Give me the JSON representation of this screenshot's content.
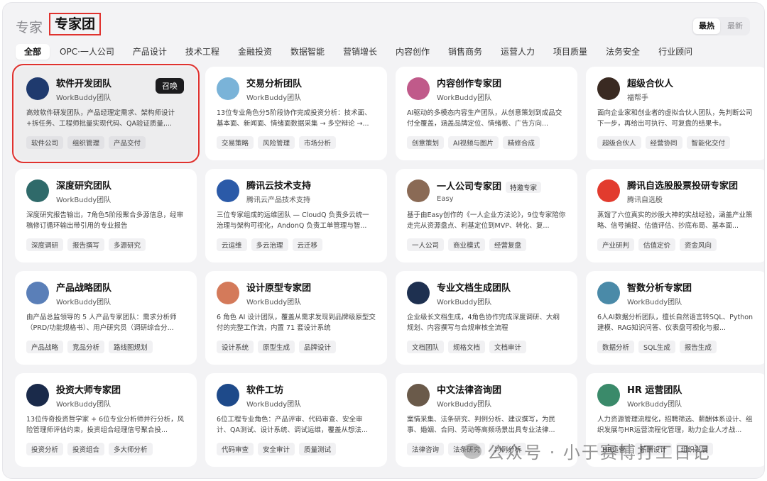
{
  "header": {
    "title_dim": "专家",
    "title_main": "专家团"
  },
  "sort": {
    "hot": "最热",
    "new": "最新"
  },
  "tabs": [
    "全部",
    "OPC·一人公司",
    "产品设计",
    "技术工程",
    "金融投资",
    "数据智能",
    "营销增长",
    "内容创作",
    "销售商务",
    "运营人力",
    "项目质量",
    "法务安全",
    "行业顾问"
  ],
  "cards": [
    {
      "name": "软件开发团队",
      "org": "WorkBuddy团队",
      "desc": "高效软件研发团队，产品经理定需求、架构师设计+拆任务、工程师批量实现代码、QA验证质量,...",
      "tags": [
        "软件公司",
        "组织管理",
        "产品交付"
      ],
      "avatar_color": "#1f3a6e",
      "summon": "召唤"
    },
    {
      "name": "交易分析团队",
      "org": "WorkBuddy团队",
      "desc": "13位专业角色分5阶段协作完成投资分析：技术面、基本面、新闻面、情绪面数据采集 → 多空辩论 →...",
      "tags": [
        "交易策略",
        "风险管理",
        "市场分析"
      ],
      "avatar_color": "#7ab3d8"
    },
    {
      "name": "内容创作专家团",
      "org": "WorkBuddy团队",
      "desc": "AI驱动的多模态内容生产团队，从创意策划到成品交付全覆盖，涵盖品牌定位、情绪板、广告方向...",
      "tags": [
        "创意策划",
        "AI视频与图片",
        "精修合成"
      ],
      "avatar_color": "#c05a8a"
    },
    {
      "name": "超级合伙人",
      "org": "福帮手",
      "desc": "面向企业家和创业者的虚拟合伙人团队，先判断公司下一步，再给出可执行、可复盘的结果卡。",
      "tags": [
        "超级合伙人",
        "经营协同",
        "智能化交付"
      ],
      "avatar_color": "#3a2a22"
    },
    {
      "name": "深度研究团队",
      "org": "WorkBuddy团队",
      "desc": "深度研究报告输出，7角色5阶段聚合多源信息，经审稿修订循环输出带引用的专业报告",
      "tags": [
        "深度调研",
        "报告撰写",
        "多源研究"
      ],
      "avatar_color": "#2f6a6a"
    },
    {
      "name": "腾讯云技术支持",
      "org": "腾讯云产品技术支持",
      "desc": "三位专家组成的运维团队 — CloudQ 负责多云统一治理与架构可视化，AndonQ 负责工单管理与智...",
      "tags": [
        "云运维",
        "多云治理",
        "云迁移"
      ],
      "avatar_color": "#2b5aa8"
    },
    {
      "name": "一人公司专家团",
      "org": "Easy",
      "badge": "特邀专家",
      "desc": "基于由Easy创作的《一人企业方法论》，9位专家陪你走完从资源盘点、利基定位到MVP、转化、复...",
      "tags": [
        "一人公司",
        "商业模式",
        "经营复盘"
      ],
      "avatar_color": "#8a6a55"
    },
    {
      "name": "腾讯自选股股票投研专家团",
      "org": "腾讯自选股",
      "desc": "蒸馏了六位真实的炒股大神的实战经验，涵盖产业策略、信号捕捉、估值评估、抄底布局、基本面...",
      "tags": [
        "产业研判",
        "估值定价",
        "资金风向"
      ],
      "avatar_color": "#e23b2e"
    },
    {
      "name": "产品战略团队",
      "org": "WorkBuddy团队",
      "desc": "由产品总监领导的 5 人产品专家团队：需求分析师（PRD/功能规格书）、用户研究员（调研综合分...",
      "tags": [
        "产品战略",
        "竞品分析",
        "路线图规划"
      ],
      "avatar_color": "#5a7fb8"
    },
    {
      "name": "设计原型专家团",
      "org": "WorkBuddy团队",
      "desc": "6 角色 AI 设计团队，覆盖从需求发现到品牌级原型交付的完整工作流，内置 71 套设计系统",
      "tags": [
        "设计系统",
        "原型生成",
        "品牌设计"
      ],
      "avatar_color": "#d47a5a"
    },
    {
      "name": "专业文档生成团队",
      "org": "WorkBuddy团队",
      "desc": "企业级长文档生成，4角色协作完成深度调研、大纲规划、内容撰写与合规审核全流程",
      "tags": [
        "文档团队",
        "规格文档",
        "文档审计"
      ],
      "avatar_color": "#1e3050"
    },
    {
      "name": "智数分析专家团",
      "org": "WorkBuddy团队",
      "desc": "6人AI数据分析团队，擅长自然语言转SQL、Python建模、RAG知识问答、仪表盘可视化与报...",
      "tags": [
        "数据分析",
        "SQL生成",
        "报告生成"
      ],
      "avatar_color": "#4a8aa8"
    },
    {
      "name": "投资大师专家团",
      "org": "WorkBuddy团队",
      "desc": "13位传奇投资哲学家 + 6位专业分析师并行分析，风险管理师评估约束，投资组合经理信号聚合投...",
      "tags": [
        "投资分析",
        "投资组合",
        "多大师分析"
      ],
      "avatar_color": "#1a2a4a"
    },
    {
      "name": "软件工坊",
      "org": "WorkBuddy团队",
      "desc": "6位工程专业角色：产品评审、代码审查、安全审计、QA测试、设计系统、调试运维，覆盖从想法...",
      "tags": [
        "代码审查",
        "安全审计",
        "质量测试"
      ],
      "avatar_color": "#1e4a8a"
    },
    {
      "name": "中文法律咨询团",
      "org": "WorkBuddy团队",
      "desc": "案情采集、法条研究、判例分析、建议撰写，为民事、婚姻、合同、劳动等高频场景出具专业法律...",
      "tags": [
        "法律咨询",
        "法条研究",
        "判例分析"
      ],
      "avatar_color": "#6a5a4a"
    },
    {
      "name": "HR 运营团队",
      "org": "WorkBuddy团队",
      "desc": "人力资源管理流程化，招聘筛选、薪酬体系设计、组织发展与HR运营流程化管理，助力企业人才战...",
      "tags": [
        "HR运营",
        "薪酬设计",
        "组织发展"
      ],
      "avatar_color": "#3a8a6a"
    }
  ],
  "watermark": "公众号 · 小于赛博打工日记"
}
